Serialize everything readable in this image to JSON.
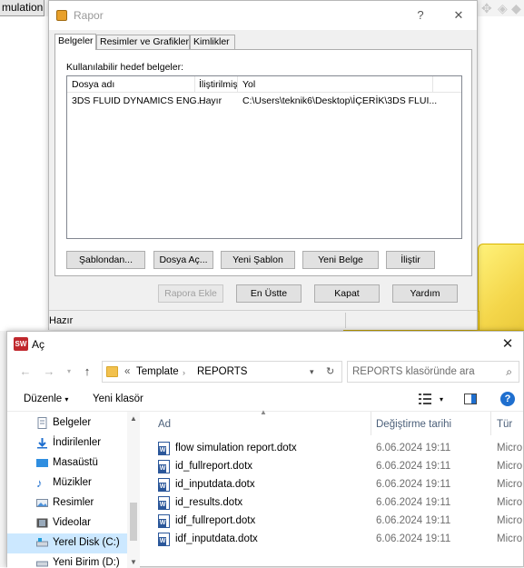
{
  "background_app": {
    "tab_label": "mulation"
  },
  "rapor_dialog": {
    "title": "Rapor",
    "help_glyph": "?",
    "close_glyph": "✕",
    "tabs": [
      "Belgeler",
      "Resimler ve Grafikler",
      "Kimlikler"
    ],
    "active_tab": "Belgeler",
    "panel_label": "Kullanılabilir hedef belgeler:",
    "columns": [
      "Dosya adı",
      "İliştirilmiş",
      "Yol"
    ],
    "rows": [
      {
        "dosya_adi": "3DS FLUID DYNAMICS ENG...",
        "ilistirilmis": "Hayır",
        "yol": "C:\\Users\\teknik6\\Desktop\\İÇERİK\\3DS FLUI..."
      }
    ],
    "panel_buttons": [
      "Şablondan...",
      "Dosya Aç...",
      "Yeni Şablon",
      "Yeni Belge",
      "İliştir"
    ],
    "bottom_buttons": [
      "Rapora Ekle",
      "En Üstte",
      "Kapat",
      "Yardım"
    ],
    "status_text": "Hazır"
  },
  "open_dialog": {
    "title": "Aç",
    "app_icon_text": "SW",
    "breadcrumb_overflow": "«",
    "breadcrumb": [
      "Template",
      "REPORTS"
    ],
    "search_placeholder": "REPORTS klasöründe ara",
    "organize_label": "Düzenle",
    "new_folder_label": "Yeni klasör",
    "sidebar_items": [
      {
        "label": "Belgeler",
        "icon": "documents-icon"
      },
      {
        "label": "İndirilenler",
        "icon": "downloads-icon"
      },
      {
        "label": "Masaüstü",
        "icon": "desktop-icon"
      },
      {
        "label": "Müzikler",
        "icon": "music-icon"
      },
      {
        "label": "Resimler",
        "icon": "pictures-icon"
      },
      {
        "label": "Videolar",
        "icon": "videos-icon"
      },
      {
        "label": "Yerel Disk (C:)",
        "icon": "drive-icon",
        "selected": true
      },
      {
        "label": "Yeni Birim (D:)",
        "icon": "drive-icon"
      }
    ],
    "columns": [
      "Ad",
      "Değiştirme tarihi",
      "Tür"
    ],
    "files": [
      {
        "name": "flow simulation report.dotx",
        "date": "6.06.2024 19:11",
        "type": "Micro"
      },
      {
        "name": "id_fullreport.dotx",
        "date": "6.06.2024 19:11",
        "type": "Micro"
      },
      {
        "name": "id_inputdata.dotx",
        "date": "6.06.2024 19:11",
        "type": "Micro"
      },
      {
        "name": "id_results.dotx",
        "date": "6.06.2024 19:11",
        "type": "Micro"
      },
      {
        "name": "idf_fullreport.dotx",
        "date": "6.06.2024 19:11",
        "type": "Micro"
      },
      {
        "name": "idf_inputdata.dotx",
        "date": "6.06.2024 19:11",
        "type": "Micro"
      }
    ],
    "colors": {
      "selection": "#cce8ff",
      "help": "#1f6fcf",
      "word_icon": "#2b579a"
    }
  }
}
